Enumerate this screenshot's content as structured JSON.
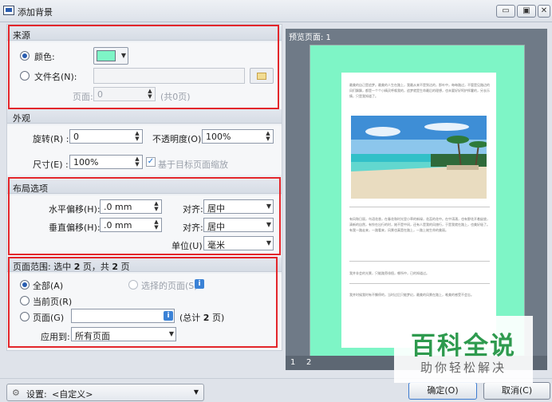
{
  "window": {
    "title": "添加背景",
    "controls": [
      "▭",
      "▣",
      "✕"
    ]
  },
  "source": {
    "section_title": "来源",
    "color_label": "颜色:",
    "color_value": "#7ef5c6",
    "file_label": "文件名(N):",
    "file_value": "",
    "page_label": "页面:",
    "page_value": "0",
    "page_total": "(共0页)"
  },
  "appearance": {
    "section_title": "外观",
    "rotate_label": "旋转(R) :",
    "rotate_value": "0",
    "opacity_label": "不透明度(O):",
    "opacity_value": "100%",
    "size_label": "尺寸(E) :",
    "size_value": "100%",
    "scale_check_label": "基于目标页面缩放",
    "scale_checked": true
  },
  "layout": {
    "section_title": "布局选项",
    "h_offset_label": "水平偏移(H):",
    "h_offset_value": ".0 mm",
    "v_offset_label": "垂直偏移(H):",
    "v_offset_value": ".0 mm",
    "align_label": "对齐:",
    "h_align_value": "居中",
    "v_align_value": "居中",
    "unit_label": "单位(U):",
    "unit_value": "毫米"
  },
  "range": {
    "title_prefix": "页面范围: 选中",
    "selected_count": "2",
    "title_mid": "页，共",
    "total_count": "2",
    "title_suffix": "页",
    "all_label": "全部(A)",
    "selected_label": "选择的页面(S)",
    "current_label": "当前页(R)",
    "pages_label": "页面(G)",
    "pages_value": "",
    "total_prefix": "(总计",
    "total_value": "2",
    "total_suffix": "页)",
    "apply_label": "应用到:",
    "apply_value": "所有页面",
    "info_icon": "i"
  },
  "preview": {
    "header": "预览页面: 1",
    "pages": [
      "1",
      "2"
    ],
    "doc_text_1": "最美的自己是追梦。最美的人生在路上，我最从来不是到达的，那叶中，每每路过，不管是见路边的风们飘飘，都是一个个小精灵呼唤我的，追梦就是生命最后的理想，也未要好好呵护挥霍的，另长乐情，只是我知道了。",
    "doc_text_2": "有风和日丽，鸟语花香，在春花和时光里小草的新绿，花蕊的花中。在中涛涌，也有野花开着绽放，清新的自然，有铃在出行的时，她不是中间，还有人是我的风旅行，于是我就在路上，也美好极了。有我一路走来，一路看来，风景也真是在路上，一路上她生命的美丽。",
    "doc_text_3": "我并非会的光景，只能路旁徘徊，哪所中，已的知道过。",
    "doc_text_4": "我并时候我时有不懈停的，当时过后只能梦幻，最美的风景在路上，唯美的感受不会忘。"
  },
  "footer": {
    "settings_label": "设置:",
    "settings_value": "<自定义>",
    "ok_label": "确定(O)",
    "cancel_label": "取消(C)"
  },
  "watermark": {
    "main": "百科全说",
    "sub": "助你轻松解决"
  },
  "colors": {
    "accent_red": "#e3262b",
    "bg_preview": "#7ef5c6",
    "watermark_green": "#2e9a4e"
  }
}
